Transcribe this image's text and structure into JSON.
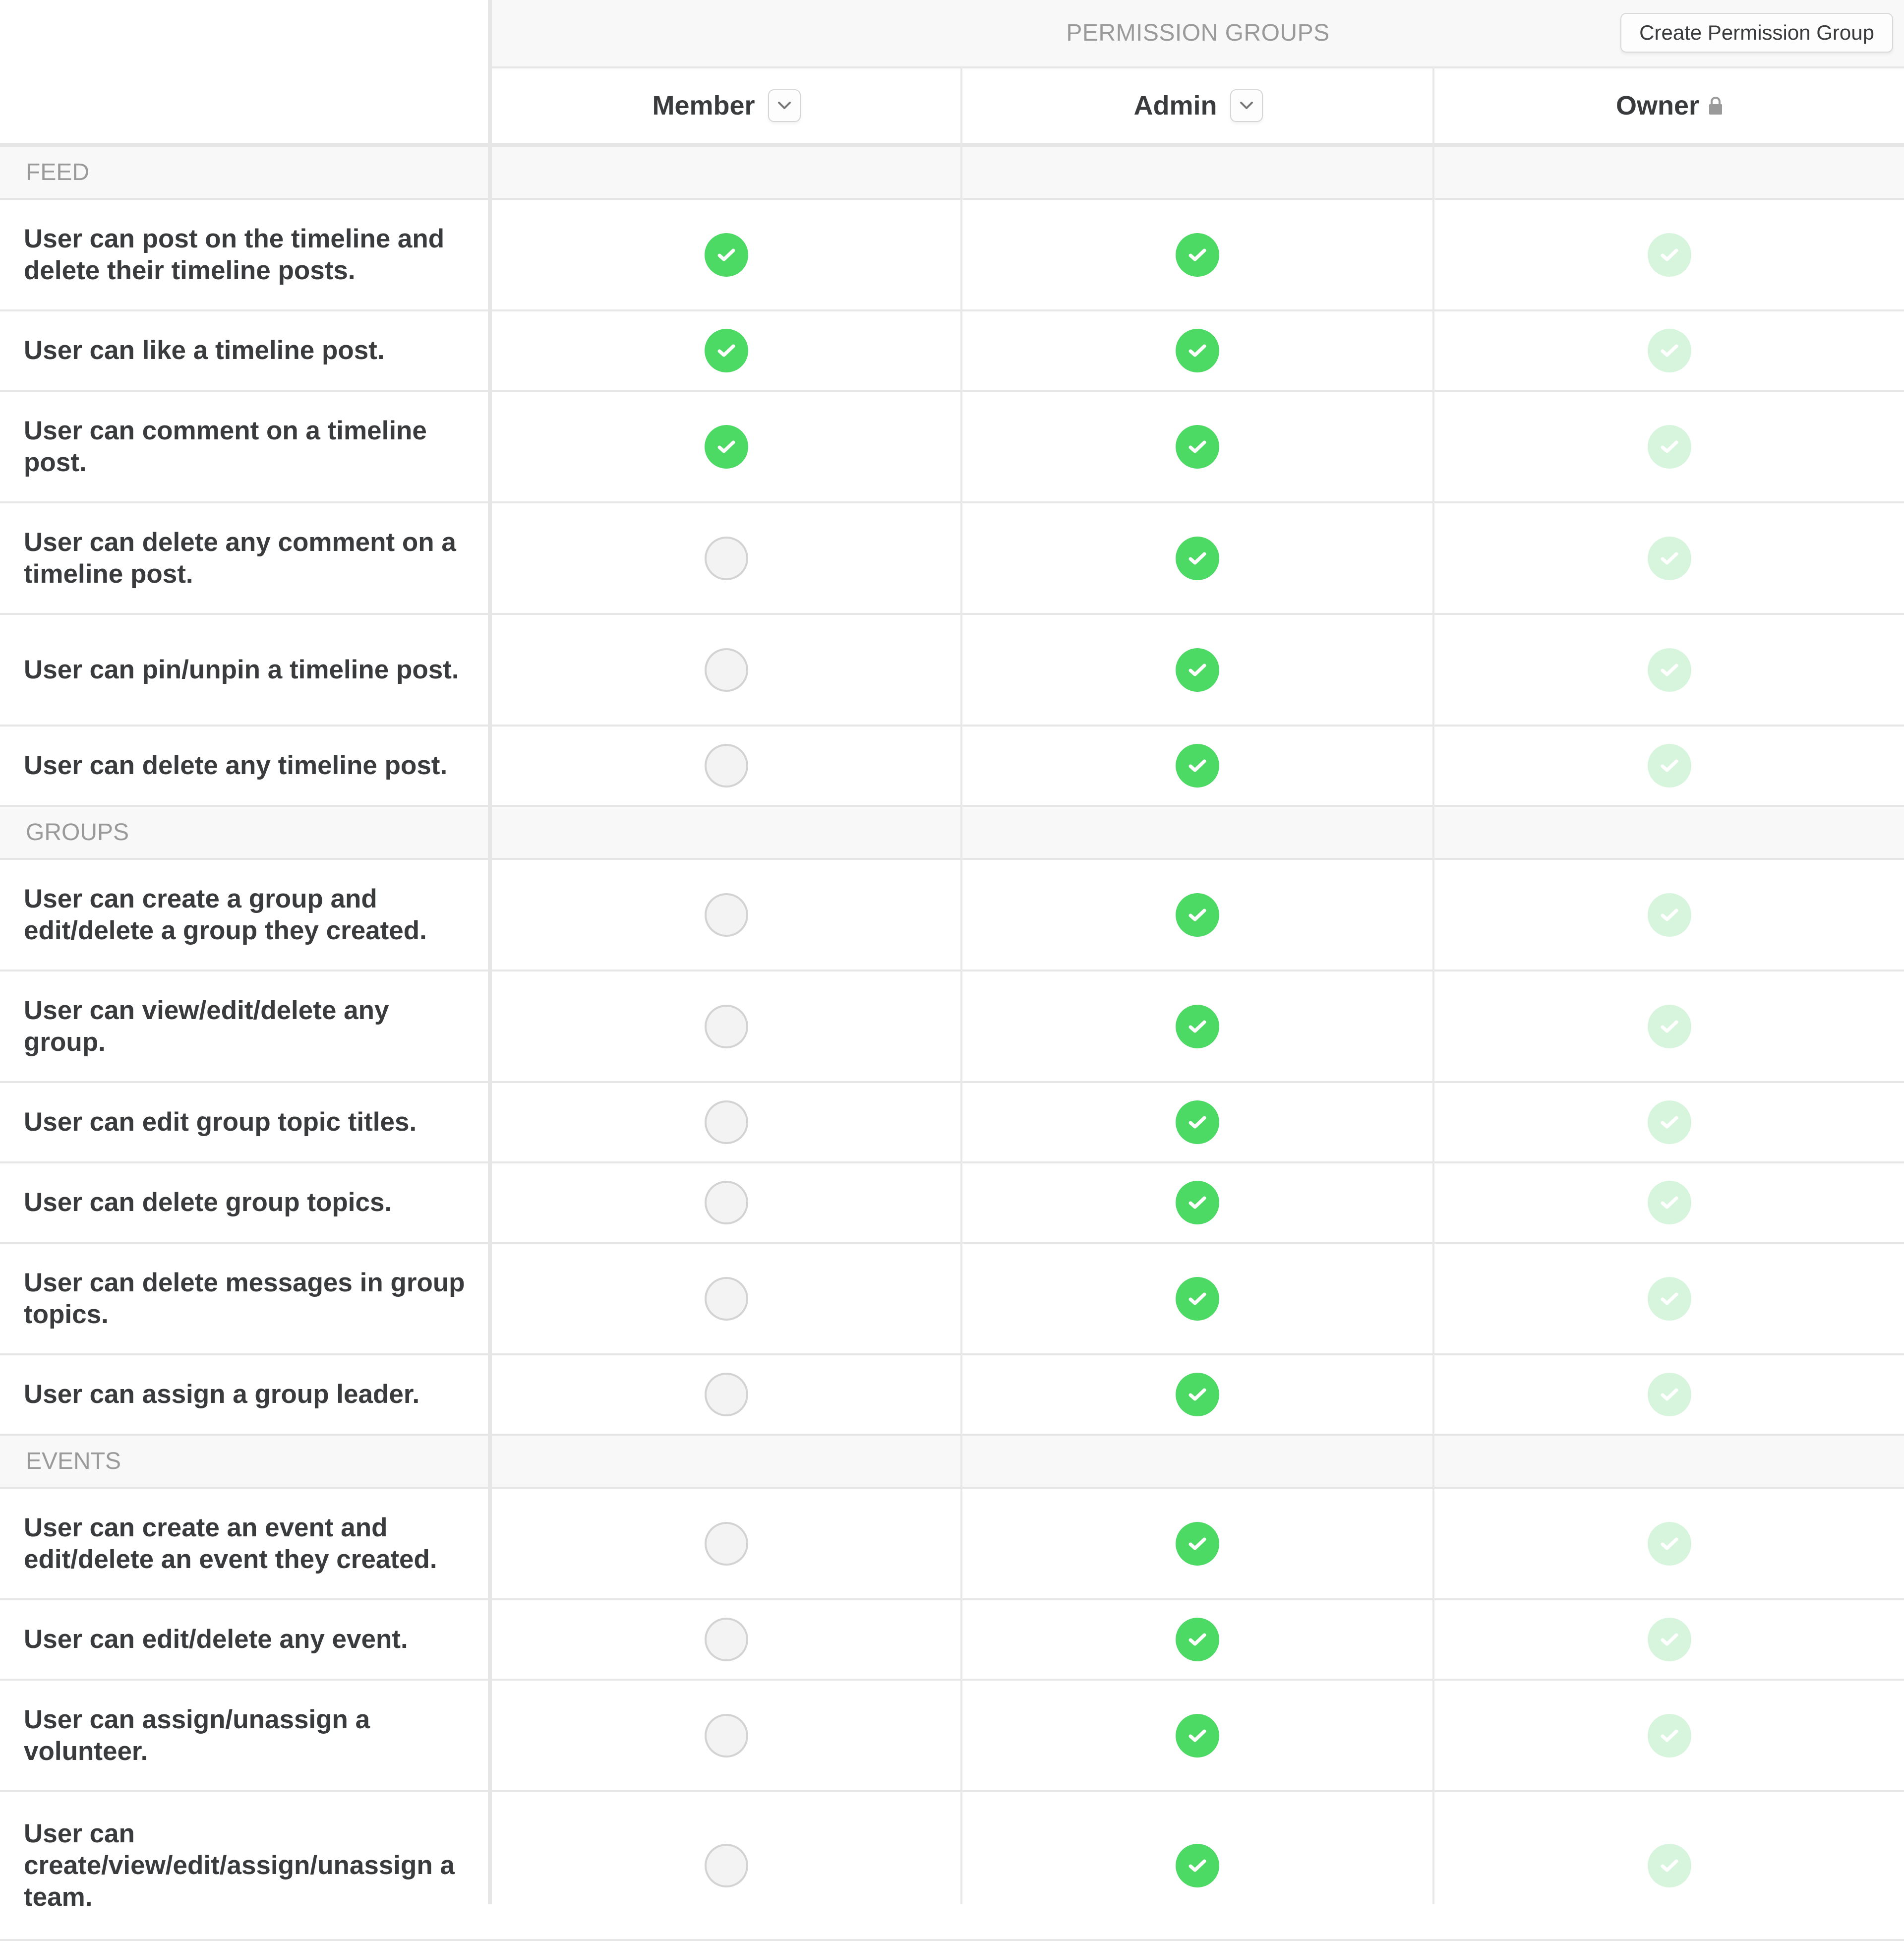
{
  "header": {
    "title": "PERMISSION GROUPS",
    "create_button_label": "Create Permission Group"
  },
  "columns": [
    {
      "label": "Member",
      "control": "chevron-down-icon",
      "locked": false
    },
    {
      "label": "Admin",
      "control": "chevron-down-icon",
      "locked": false
    },
    {
      "label": "Owner",
      "control": "lock-icon",
      "locked": true
    }
  ],
  "colors": {
    "enabled": "#4cd964",
    "locked_enabled": "#d7f5dd",
    "disabled_fill": "#f3f3f3",
    "disabled_border": "#d3d3d3",
    "section_label": "#9a9a9a",
    "text": "#3a3b3d"
  },
  "sections": [
    {
      "label": "FEED",
      "permissions": [
        {
          "label": "User can post on the timeline and delete their timeline posts.",
          "lines": 2,
          "member": true,
          "admin": true,
          "owner": true
        },
        {
          "label": "User can like a timeline post.",
          "lines": 1,
          "member": true,
          "admin": true,
          "owner": true
        },
        {
          "label": "User can comment on a timeline post.",
          "lines": 2,
          "member": true,
          "admin": true,
          "owner": true
        },
        {
          "label": "User can delete any comment on a timeline post.",
          "lines": 2,
          "member": false,
          "admin": true,
          "owner": true
        },
        {
          "label": "User can pin/unpin a timeline post.",
          "lines": 2,
          "member": false,
          "admin": true,
          "owner": true
        },
        {
          "label": "User can delete any timeline post.",
          "lines": 1,
          "member": false,
          "admin": true,
          "owner": true
        }
      ]
    },
    {
      "label": "GROUPS",
      "permissions": [
        {
          "label": "User can create a group and edit/delete a group they created.",
          "lines": 2,
          "member": false,
          "admin": true,
          "owner": true
        },
        {
          "label": "User can view/edit/delete any group.",
          "lines": 2,
          "member": false,
          "admin": true,
          "owner": true
        },
        {
          "label": "User can edit group topic titles.",
          "lines": 1,
          "member": false,
          "admin": true,
          "owner": true
        },
        {
          "label": "User can delete group topics.",
          "lines": 1,
          "member": false,
          "admin": true,
          "owner": true
        },
        {
          "label": "User can delete messages in group topics.",
          "lines": 2,
          "member": false,
          "admin": true,
          "owner": true
        },
        {
          "label": "User can assign a group leader.",
          "lines": 1,
          "member": false,
          "admin": true,
          "owner": true
        }
      ]
    },
    {
      "label": "EVENTS",
      "permissions": [
        {
          "label": "User can create an event and edit/delete an event they created.",
          "lines": 2,
          "member": false,
          "admin": true,
          "owner": true
        },
        {
          "label": "User can edit/delete any event.",
          "lines": 1,
          "member": false,
          "admin": true,
          "owner": true
        },
        {
          "label": "User can assign/unassign a volunteer.",
          "lines": 2,
          "member": false,
          "admin": true,
          "owner": true
        },
        {
          "label": "User can create/view/edit/assign/unassign a team.",
          "lines": 3,
          "member": false,
          "admin": true,
          "owner": true
        }
      ]
    }
  ]
}
